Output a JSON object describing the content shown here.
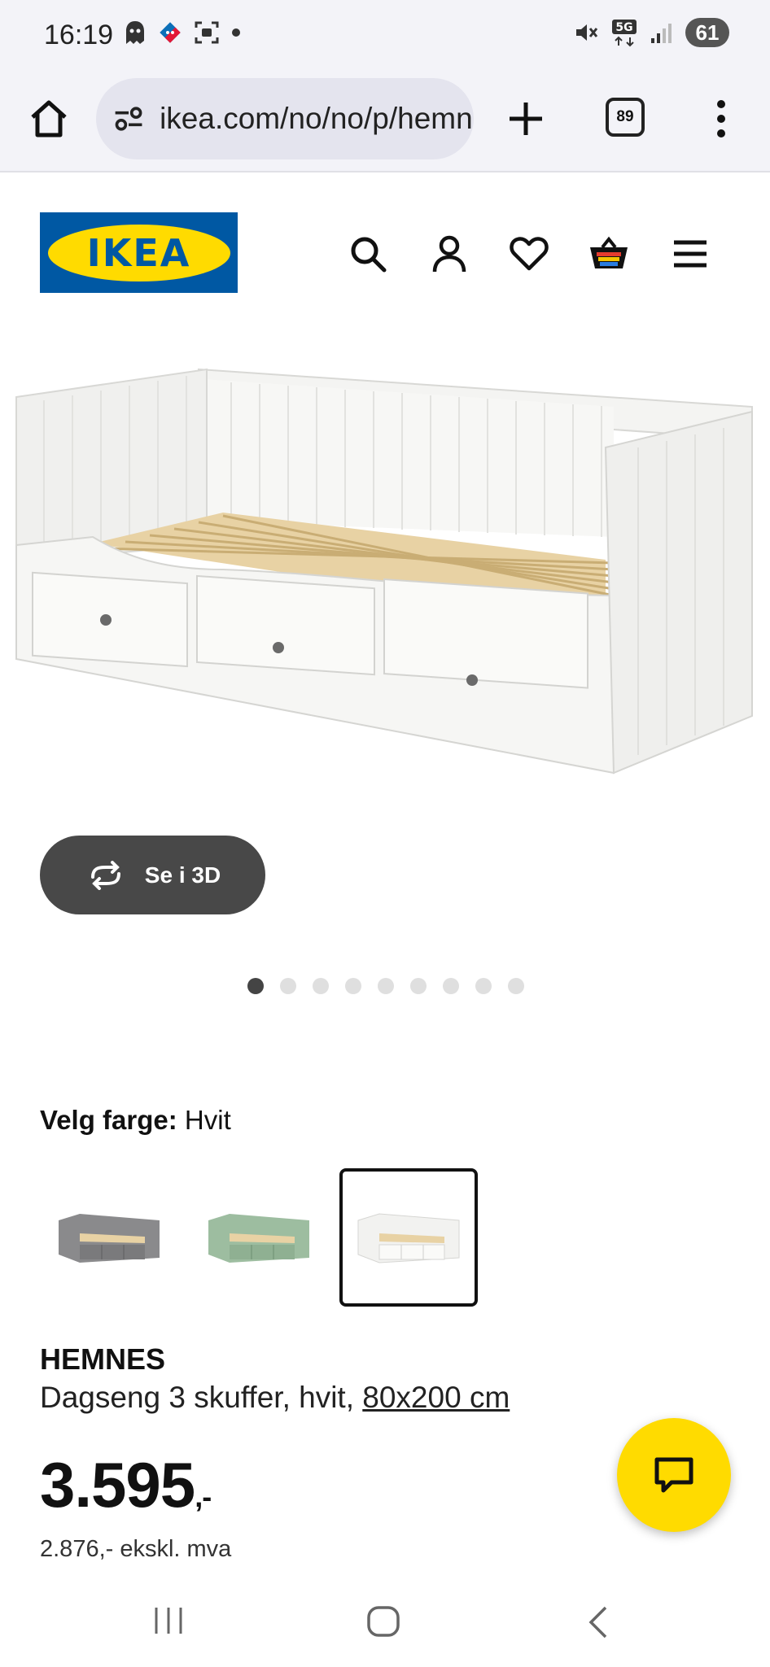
{
  "status_bar": {
    "time": "16:19",
    "battery": "61",
    "network": "5G"
  },
  "browser": {
    "url": "ikea.com/no/no/p/hemnes",
    "tab_count": "89"
  },
  "header": {
    "logo_text": "IKEA"
  },
  "gallery": {
    "view_3d_label": "Se i 3D",
    "dot_count": 9,
    "active_dot": 0
  },
  "color": {
    "label": "Velg farge:",
    "value": "Hvit",
    "options": [
      "grey",
      "green",
      "white"
    ],
    "selected": 2
  },
  "product": {
    "name": "HEMNES",
    "description": "Dagseng 3 skuffer, hvit,",
    "size": "80x200 cm",
    "price": "3.595",
    "price_suffix": ",-",
    "price_ex_vat": "2.876,- ekskl. mva"
  },
  "colors": {
    "brand_blue": "#0058a3",
    "brand_yellow": "#ffdb00"
  }
}
